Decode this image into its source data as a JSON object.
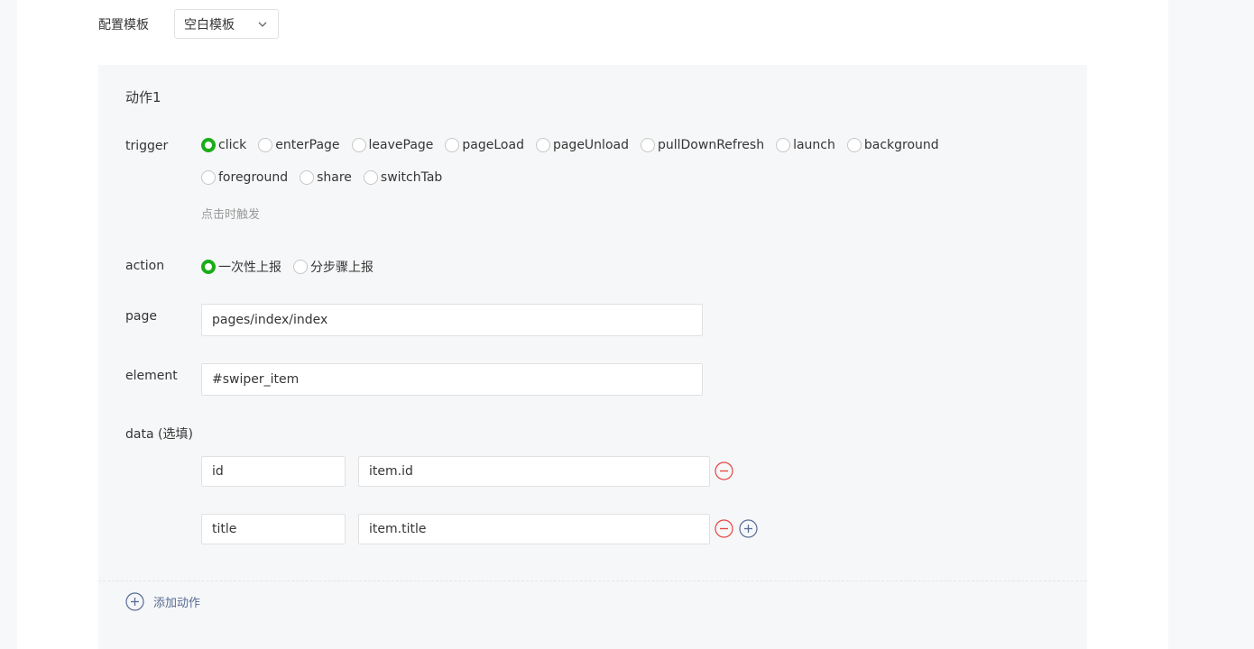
{
  "template": {
    "label": "配置模板",
    "selected": "空白模板"
  },
  "action_card": {
    "title": "动作1",
    "trigger": {
      "label": "trigger",
      "options_row1": [
        "click",
        "enterPage",
        "leavePage",
        "pageLoad",
        "pageUnload",
        "pullDownRefresh",
        "launch",
        "background"
      ],
      "options_row2": [
        "foreground",
        "share",
        "switchTab"
      ],
      "selected": "click",
      "hint": "点击时触发"
    },
    "action": {
      "label": "action",
      "options": [
        "一次性上报",
        "分步骤上报"
      ],
      "selected": "一次性上报"
    },
    "page": {
      "label": "page",
      "value": "pages/index/index"
    },
    "element": {
      "label": "element",
      "value": "#swiper_item"
    },
    "data": {
      "label": "data (选填)",
      "rows": [
        {
          "key": "id",
          "value": "item.id"
        },
        {
          "key": "title",
          "value": "item.title"
        }
      ]
    }
  },
  "add_action_label": "添加动作",
  "colors": {
    "accent_green": "#1aad19",
    "remove_red": "#e64340",
    "link_blue": "#576b95"
  }
}
